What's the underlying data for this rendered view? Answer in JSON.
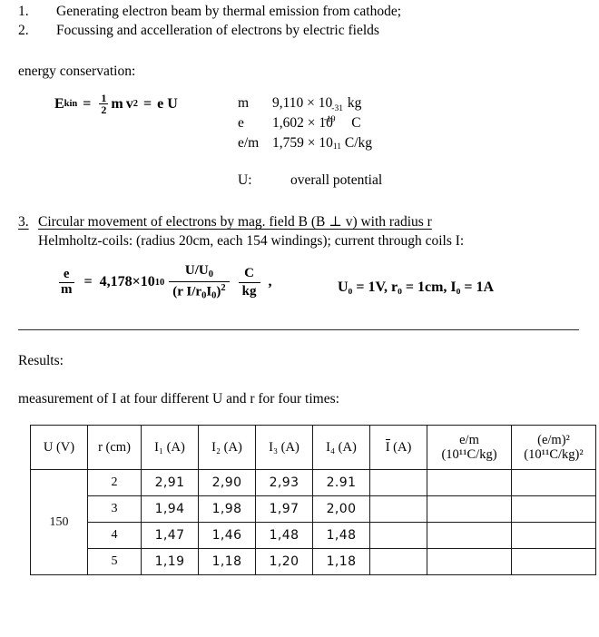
{
  "list": {
    "items": [
      {
        "num": "1.",
        "text": "Generating electron beam by thermal emission from cathode;"
      },
      {
        "num": "2.",
        "text": "Focussing and accelleration of electrons by electric fields"
      }
    ]
  },
  "energy_conservation_label": "energy conservation:",
  "ekin_formula": {
    "symbol": "E",
    "subscript": "kin",
    "eq1": "=",
    "frac_num": "1",
    "frac_den": "2",
    "m": "m",
    "v": "v",
    "v_exp": "2",
    "eq2": "=",
    "eU": "e U"
  },
  "constants": [
    {
      "symbol": "m",
      "mantissa": "9,110 × 10",
      "exponent": "-31",
      "unit": "kg"
    },
    {
      "symbol": "e",
      "mantissa": "1,602 × 10",
      "exponent": "-19",
      "unit": "C"
    },
    {
      "symbol": "e/m",
      "mantissa": "1,759 × 10",
      "exponent": "11",
      "unit": "C/kg"
    }
  ],
  "overall_potential": {
    "label": "U:",
    "text": "overall potential"
  },
  "section3": {
    "num": "3.",
    "line1": "Circular movement of electrons by mag. field  B  (B ⊥ v) with radius r",
    "line2": "Helmholtz-coils:  (radius 20cm, each 154 windings); current through coils I:"
  },
  "em_formula": {
    "lhs_num": "e",
    "lhs_den": "m",
    "equals": "=",
    "coefficient": "4,178×10",
    "coefficient_exp": "10",
    "frac_num": "U/U",
    "frac_num_sub": "0",
    "frac_den_open": "(",
    "frac_den_body": "r I/r",
    "frac_den_sub1": "0",
    "frac_den_body2": "I",
    "frac_den_sub2": "0",
    "frac_den_close": ")",
    "frac_den_exp": "2",
    "unit_num": "C",
    "unit_den": "kg",
    "comma": ",",
    "conditions": "U₀ = 1V,  r₀ = 1cm,  I₀ = 1A"
  },
  "results_label": "Results:",
  "measurement_note": "measurement of I at four different U and r for four times:",
  "table": {
    "headers": [
      {
        "main": "U (V)",
        "sub": ""
      },
      {
        "main": "r (cm)",
        "sub": ""
      },
      {
        "main": "I₁ (A)",
        "sub": ""
      },
      {
        "main": "I₂ (A)",
        "sub": ""
      },
      {
        "main": "I₃ (A)",
        "sub": ""
      },
      {
        "main": "I₄ (A)",
        "sub": ""
      },
      {
        "main": "Ī (A)",
        "sub": ""
      },
      {
        "main": "e/m",
        "sub": "(10¹¹C/kg)"
      },
      {
        "main": "(e/m)²",
        "sub": "(10¹¹C/kg)²"
      }
    ],
    "u_value": "150",
    "rows": [
      {
        "r": "2",
        "i1": "2,91",
        "i2": "2,90",
        "i3": "2,93",
        "i4": "2.91",
        "avg": "",
        "em": "",
        "em2": ""
      },
      {
        "r": "3",
        "i1": "1,94",
        "i2": "1,98",
        "i3": "1,97",
        "i4": "2,00",
        "avg": "",
        "em": "",
        "em2": ""
      },
      {
        "r": "4",
        "i1": "1,47",
        "i2": "1,46",
        "i3": "1,48",
        "i4": "1,48",
        "avg": "",
        "em": "",
        "em2": ""
      },
      {
        "r": "5",
        "i1": "1,19",
        "i2": "1,18",
        "i3": "1,20",
        "i4": "1,18",
        "avg": "",
        "em": "",
        "em2": ""
      }
    ]
  }
}
